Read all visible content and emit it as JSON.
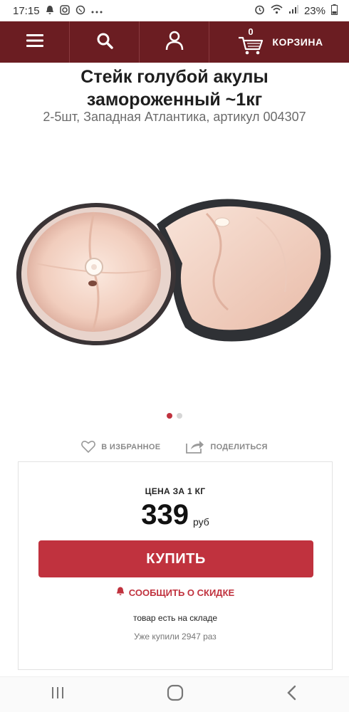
{
  "status_bar": {
    "time": "17:15",
    "battery": "23%",
    "left_icons": [
      "notification-icon",
      "instagram-icon",
      "viber-icon",
      "more-dots-icon"
    ],
    "right_icons": [
      "alarm-icon",
      "wifi-icon",
      "signal-icon",
      "battery-icon"
    ]
  },
  "nav": {
    "cart_count": "0",
    "cart_label": "КОРЗИНА"
  },
  "product": {
    "title_line1": "Стейк голубой акулы",
    "title_line2": "замороженный ~1кг",
    "subtitle": "2-5шт, Западная Атлантика, артикул 004307",
    "gallery_total": 2,
    "gallery_active": 1
  },
  "actions": {
    "favorite_label": "В ИЗБРАННОЕ",
    "share_label": "ПОДЕЛИТЬСЯ"
  },
  "price": {
    "label": "ЦЕНА ЗА 1 КГ",
    "value": "339",
    "unit": "руб",
    "buy_label": "КУПИТЬ",
    "discount_label": "СООБЩИТЬ О СКИДКЕ",
    "stock_text": "товар есть на складе",
    "bought_text": "Уже купили 2947 раз"
  },
  "colors": {
    "header_bg": "#6b1d22",
    "accent": "#c0323e"
  }
}
